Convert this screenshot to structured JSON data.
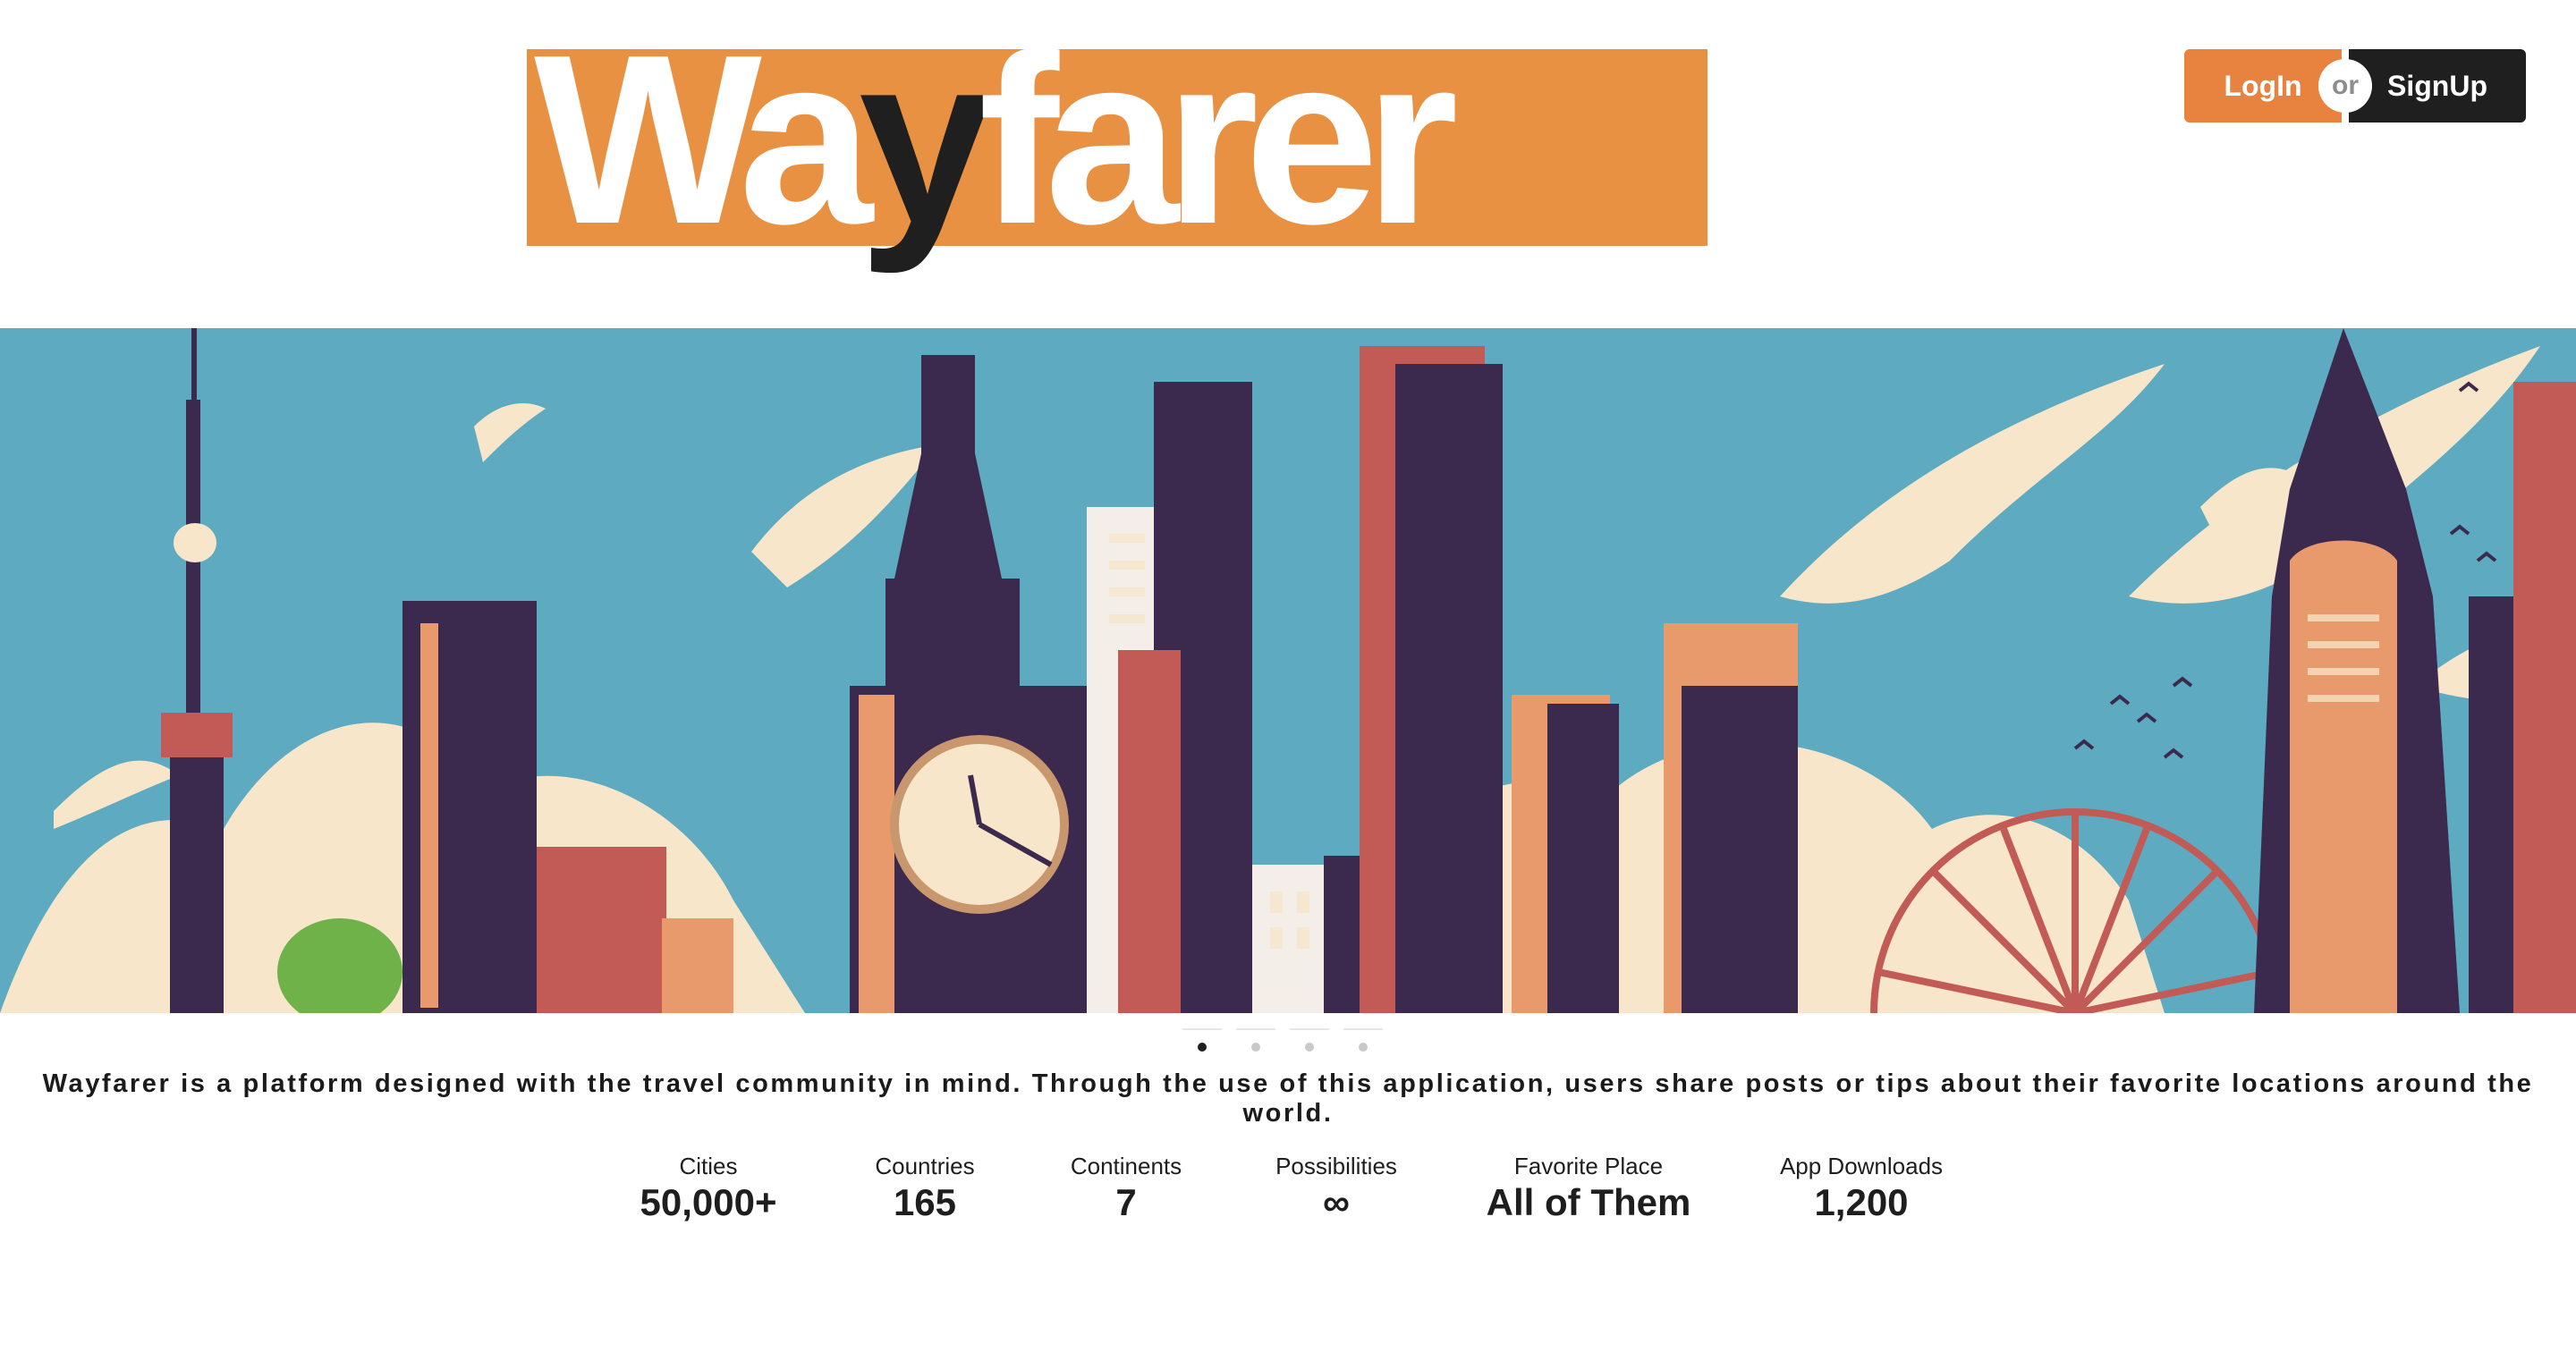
{
  "logo": {
    "part1": "Wa",
    "part2": "y",
    "part3": "farer"
  },
  "auth": {
    "login_label": "LogIn",
    "or_label": "or",
    "signup_label": "SignUp"
  },
  "colors": {
    "accent": "#e8823f",
    "logo_orange": "#e99143",
    "dark": "#1f1f1f",
    "sky": "#5eaac0",
    "building": "#3b2a4e"
  },
  "carousel": {
    "slides": 4,
    "active": 0
  },
  "description": "Wayfarer is a platform designed with the travel community in mind. Through the use of this application, users share posts or tips about their favorite locations around the world.",
  "stats": [
    {
      "label": "Cities",
      "value": "50,000+"
    },
    {
      "label": "Countries",
      "value": "165"
    },
    {
      "label": "Continents",
      "value": "7"
    },
    {
      "label": "Possibilities",
      "value": "∞"
    },
    {
      "label": "Favorite Place",
      "value": "All of Them"
    },
    {
      "label": "App Downloads",
      "value": "1,200"
    }
  ]
}
